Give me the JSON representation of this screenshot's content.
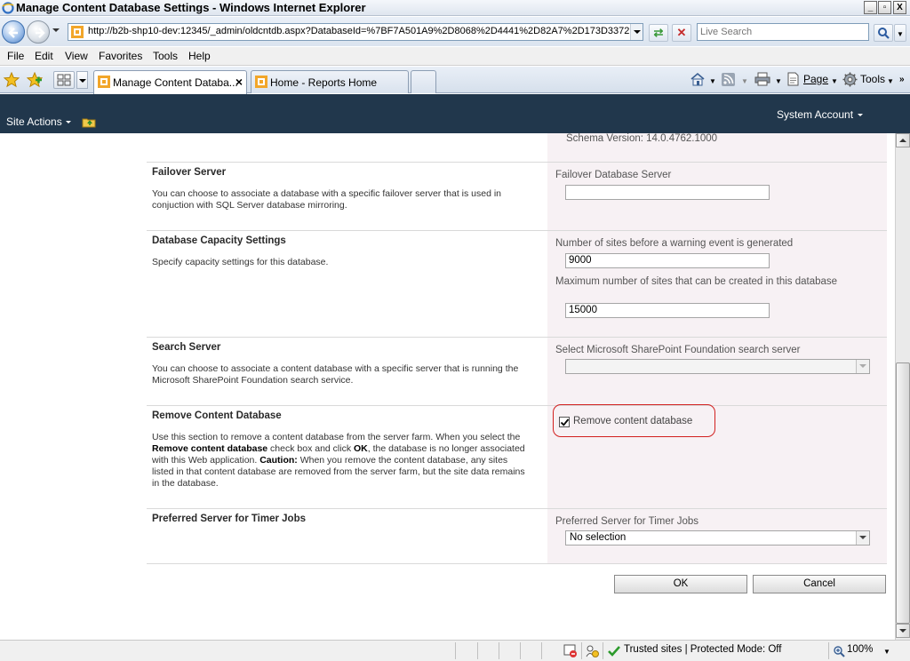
{
  "window": {
    "title": "Manage Content Database Settings - Windows Internet Explorer",
    "min_label": "_",
    "max_label": "▫",
    "close_label": "X"
  },
  "address": {
    "url": "http://b2b-shp10-dev:12345/_admin/oldcntdb.aspx?DatabaseId=%7BF7A501A9%2D8068%2D4441%2D82A7%2D173D3372",
    "search_placeholder": "Live Search"
  },
  "menu": {
    "file": "File",
    "edit": "Edit",
    "view": "View",
    "favorites": "Favorites",
    "tools": "Tools",
    "help": "Help"
  },
  "tabs": [
    {
      "label": "Manage Content Databa..."
    },
    {
      "label": "Home - Reports Home"
    }
  ],
  "commandbar": {
    "page": "Page",
    "tools": "Tools"
  },
  "sharepoint": {
    "site_actions": "Site Actions",
    "account": "System Account"
  },
  "form": {
    "schema_version": "Schema Version: 14.0.4762.1000",
    "failover": {
      "title": "Failover Server",
      "desc": "You can choose to associate a database with a specific failover server that is used in conjuction with SQL Server database mirroring.",
      "field_label": "Failover Database Server",
      "value": ""
    },
    "capacity": {
      "title": "Database Capacity Settings",
      "desc": "Specify capacity settings for this database.",
      "warning_label": "Number of sites before a warning event is generated",
      "warning_value": "9000",
      "max_label": "Maximum number of sites that can be created in this database",
      "max_value": "15000"
    },
    "search": {
      "title": "Search Server",
      "desc": "You can choose to associate a content database with a specific server that is running the Microsoft SharePoint Foundation search service.",
      "field_label": "Select Microsoft SharePoint Foundation search server",
      "value": ""
    },
    "remove": {
      "title": "Remove Content Database",
      "desc_1": "Use this section to remove a content database from the server farm. When you select the ",
      "desc_bold_1": "Remove content database",
      "desc_2": " check box and click ",
      "desc_bold_2": "OK",
      "desc_3": ", the database is no longer associated with this Web application. ",
      "desc_bold_3": "Caution:",
      "desc_4": " When you remove the content database, any sites listed in that content database are removed from the server farm, but the site data remains in the database.",
      "checkbox_label": "Remove content database",
      "checked": true
    },
    "timer": {
      "title": "Preferred Server for Timer Jobs",
      "field_label": "Preferred Server for Timer Jobs",
      "value": "No selection"
    },
    "ok_label": "OK",
    "cancel_label": "Cancel"
  },
  "status": {
    "zone": "Trusted sites | Protected Mode: Off",
    "zoom": "100%"
  },
  "colors": {
    "ribbon": "#21374c",
    "field_column": "#f7f1f4",
    "highlight": "#d2201f"
  }
}
